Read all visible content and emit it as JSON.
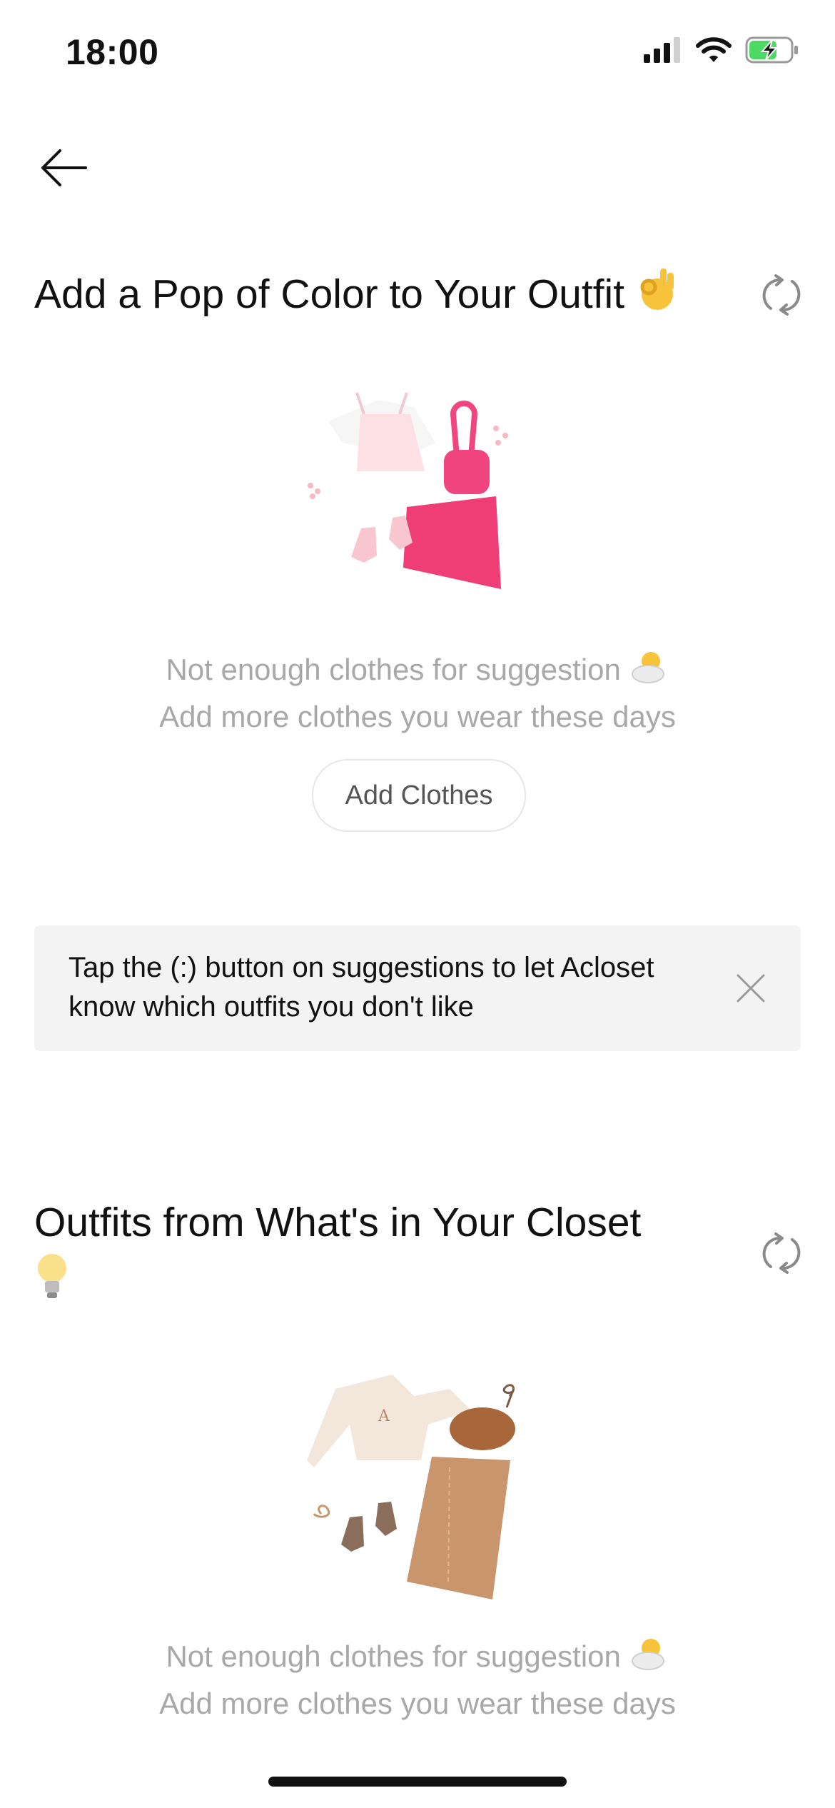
{
  "status_bar": {
    "time": "18:00",
    "icons": [
      "signal-icon",
      "wifi-icon",
      "battery-charging-icon"
    ]
  },
  "nav": {
    "back_icon": "arrow-left-icon"
  },
  "section1": {
    "title": "Add a Pop of Color to Your Outfit",
    "title_emoji": "ok-hand-emoji",
    "refresh_icon": "refresh-icon",
    "message_line1": "Not enough clothes for suggestion",
    "message_emoji": "sun-behind-cloud-emoji",
    "message_line2": "Add more clothes you wear these days",
    "add_button_label": "Add Clothes"
  },
  "tip": {
    "text": "Tap the (:) button on suggestions to let Acloset know which outfits you don't like",
    "close_icon": "close-icon"
  },
  "section2": {
    "title": "Outfits from What's in Your Closet",
    "title_emoji": "light-bulb-emoji",
    "refresh_icon": "refresh-icon",
    "message_line1": "Not enough clothes for suggestion",
    "message_emoji": "sun-behind-cloud-emoji",
    "message_line2": "Add more clothes you wear these days"
  },
  "colors": {
    "accent_pink": "#f0457f",
    "text_muted": "#a8a8a8",
    "tip_bg": "#f3f3f3",
    "battery_green": "#4cd964"
  }
}
